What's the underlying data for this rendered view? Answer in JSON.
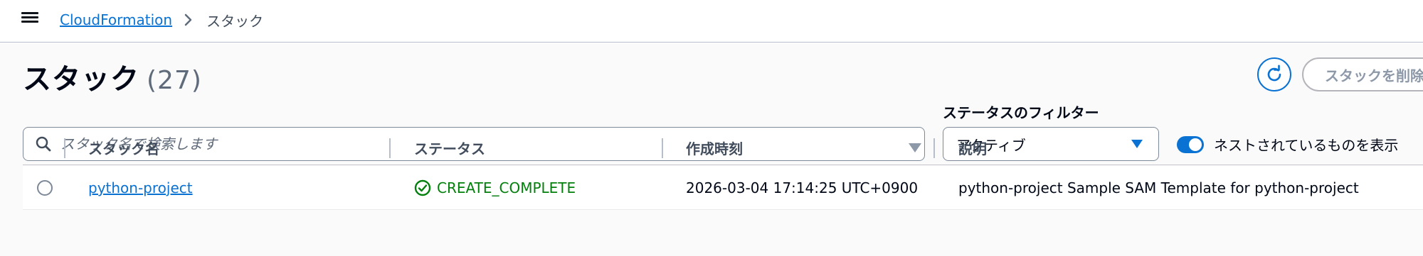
{
  "breadcrumb": {
    "root": "CloudFormation",
    "current": "スタック"
  },
  "header": {
    "title": "スタック",
    "count": "(27)",
    "delete_label": "スタックを削除"
  },
  "search": {
    "placeholder": "スタック名で検索します",
    "value": ""
  },
  "filter": {
    "label": "ステータスのフィルター",
    "selected": "アクティブ"
  },
  "nested_toggle": {
    "label": "ネストされているものを表示",
    "checked": true
  },
  "table": {
    "columns": [
      "スタック名",
      "ステータス",
      "作成時刻",
      "説明"
    ],
    "rows": [
      {
        "name": "python-project",
        "status": "CREATE_COMPLETE",
        "created": "2026-03-04 17:14:25 UTC+0900",
        "description": "python-project Sample SAM Template for python-project"
      }
    ]
  },
  "colors": {
    "accent": "#0972d3",
    "success": "#037f0c",
    "disabled": "#8d99a8"
  },
  "icons": [
    "menu-icon",
    "chevron-right-icon",
    "refresh-icon",
    "search-icon",
    "caret-down-icon",
    "sort-down-icon",
    "check-circle-icon"
  ]
}
